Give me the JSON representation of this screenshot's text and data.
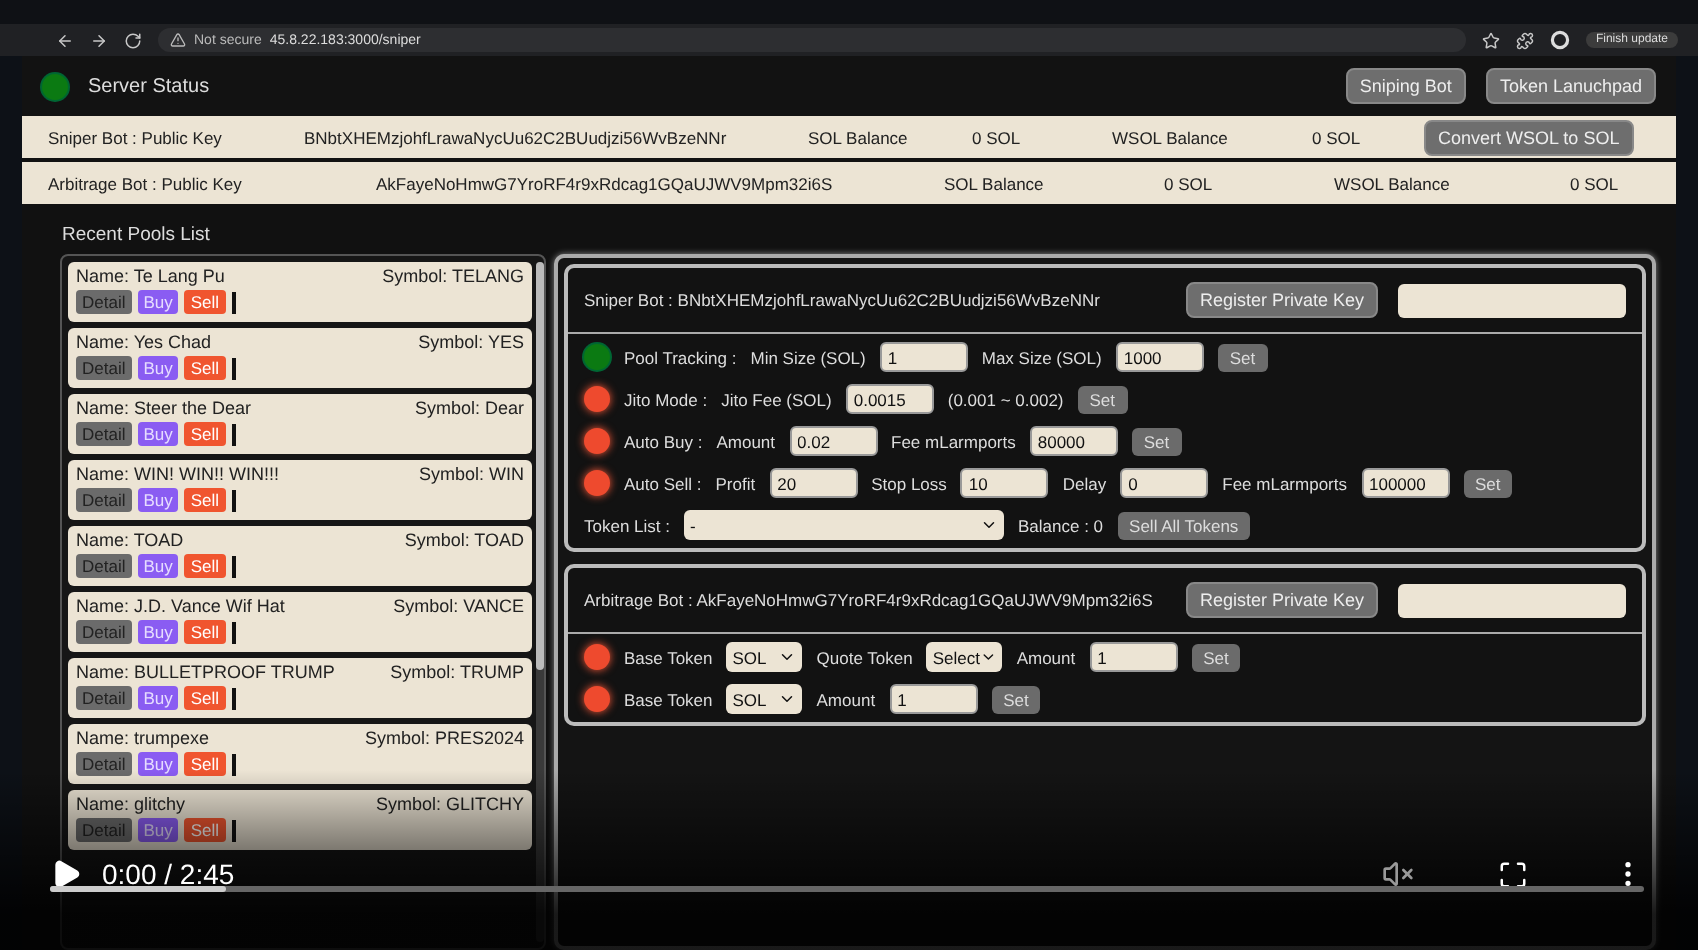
{
  "browser": {
    "security": "Not secure",
    "url": "45.8.22.183:3000/sniper",
    "update_button": "Finish update"
  },
  "header": {
    "server_status": {
      "label": "Server Status",
      "on": true
    },
    "buttons": [
      "Sniping Bot",
      "Token Lanuchpad"
    ]
  },
  "accounts": [
    {
      "label": "Sniper Bot : Public Key",
      "key": "BNbtXHEMzjohfLrawaNycUu62C2BUudjzi56WvBzeNNr",
      "balances": [
        {
          "label": "SOL Balance",
          "value": "0 SOL"
        },
        {
          "label": "WSOL Balance",
          "value": "0 SOL"
        }
      ],
      "button": "Convert WSOL to SOL"
    },
    {
      "label": "Arbitrage Bot : Public Key",
      "key": "AkFayeNoHmwG7YroRF4r9xRdcag1GQaUJWV9Mpm32i6S",
      "balances": [
        {
          "label": "SOL Balance",
          "value": "0 SOL"
        },
        {
          "label": "WSOL Balance",
          "value": "0 SOL"
        }
      ]
    }
  ],
  "pools": {
    "title": "Recent Pools List",
    "items": [
      {
        "name": "Name: Te Lang Pu",
        "symbol": "Symbol: TELANG",
        "actions": [
          {
            "label": "Detail",
            "kind": "detail"
          },
          {
            "label": "Buy",
            "kind": "buy"
          },
          {
            "label": "Sell",
            "kind": "sell"
          }
        ]
      },
      {
        "name": "Name: Yes Chad",
        "symbol": "Symbol: YES",
        "actions": [
          {
            "label": "Detail",
            "kind": "detail"
          },
          {
            "label": "Buy",
            "kind": "buy"
          },
          {
            "label": "Sell",
            "kind": "sell"
          }
        ]
      },
      {
        "name": "Name: Steer the Dear",
        "symbol": "Symbol: Dear",
        "actions": [
          {
            "label": "Detail",
            "kind": "detail"
          },
          {
            "label": "Buy",
            "kind": "buy"
          },
          {
            "label": "Sell",
            "kind": "sell"
          }
        ]
      },
      {
        "name": "Name: WIN! WIN!! WIN!!!",
        "symbol": "Symbol: WIN",
        "actions": [
          {
            "label": "Detail",
            "kind": "detail"
          },
          {
            "label": "Buy",
            "kind": "buy"
          },
          {
            "label": "Sell",
            "kind": "sell"
          }
        ]
      },
      {
        "name": "Name: TOAD",
        "symbol": "Symbol: TOAD",
        "actions": [
          {
            "label": "Detail",
            "kind": "detail"
          },
          {
            "label": "Buy",
            "kind": "buy"
          },
          {
            "label": "Sell",
            "kind": "sell"
          }
        ]
      },
      {
        "name": "Name: J.D. Vance Wif Hat",
        "symbol": "Symbol: VANCE",
        "actions": [
          {
            "label": "Detail",
            "kind": "detail"
          },
          {
            "label": "Buy",
            "kind": "buy"
          },
          {
            "label": "Sell",
            "kind": "sell"
          }
        ]
      },
      {
        "name": "Name: BULLETPROOF TRUMP",
        "symbol": "Symbol: TRUMP",
        "actions": [
          {
            "label": "Detail",
            "kind": "detail"
          },
          {
            "label": "Buy",
            "kind": "buy"
          },
          {
            "label": "Sell",
            "kind": "sell"
          }
        ]
      },
      {
        "name": "Name: trumpexe",
        "symbol": "Symbol: PRES2024",
        "actions": [
          {
            "label": "Detail",
            "kind": "detail"
          },
          {
            "label": "Buy",
            "kind": "buy"
          },
          {
            "label": "Sell",
            "kind": "sell"
          }
        ]
      },
      {
        "name": "Name: glitchy",
        "symbol": "Symbol: GLITCHY",
        "actions": [
          {
            "label": "Detail",
            "kind": "detail"
          },
          {
            "label": "Buy",
            "kind": "buy"
          },
          {
            "label": "Sell",
            "kind": "sell"
          }
        ]
      }
    ]
  },
  "bot_panels": [
    {
      "title": "Sniper Bot : BNbtXHEMzjohfLrawaNycUu62C2BUudjzi56WvBzeNNr",
      "register_button": "Register Private Key",
      "rows": [
        {
          "on": true,
          "items": [
            {
              "kind": "label",
              "text": "Pool Tracking :"
            },
            {
              "kind": "label",
              "text": "Min Size (SOL)"
            },
            {
              "kind": "input",
              "value": "1"
            },
            {
              "kind": "label",
              "text": "Max Size (SOL)"
            },
            {
              "kind": "input",
              "value": "1000"
            },
            {
              "kind": "button",
              "text": "Set"
            }
          ]
        },
        {
          "on": false,
          "items": [
            {
              "kind": "label",
              "text": "Jito Mode :"
            },
            {
              "kind": "label",
              "text": "Jito Fee (SOL)"
            },
            {
              "kind": "input",
              "value": "0.0015"
            },
            {
              "kind": "label",
              "text": "(0.001 ~ 0.002)"
            },
            {
              "kind": "button",
              "text": "Set"
            }
          ]
        },
        {
          "on": false,
          "items": [
            {
              "kind": "label",
              "text": "Auto Buy :"
            },
            {
              "kind": "label",
              "text": "Amount"
            },
            {
              "kind": "input",
              "value": "0.02"
            },
            {
              "kind": "label",
              "text": "Fee mLarmports"
            },
            {
              "kind": "input",
              "value": "80000"
            },
            {
              "kind": "button",
              "text": "Set"
            }
          ]
        },
        {
          "on": false,
          "items": [
            {
              "kind": "label",
              "text": "Auto Sell :"
            },
            {
              "kind": "label",
              "text": "Profit"
            },
            {
              "kind": "input",
              "value": "20"
            },
            {
              "kind": "label",
              "text": "Stop Loss"
            },
            {
              "kind": "input",
              "value": "10"
            },
            {
              "kind": "label",
              "text": "Delay"
            },
            {
              "kind": "input",
              "value": "0"
            },
            {
              "kind": "label",
              "text": "Fee mLarmports"
            },
            {
              "kind": "input",
              "value": "100000"
            },
            {
              "kind": "button",
              "text": "Set"
            }
          ]
        },
        {
          "items": [
            {
              "kind": "label",
              "text": "Token List :"
            },
            {
              "kind": "wideselect",
              "value": "-"
            },
            {
              "kind": "label",
              "text": "Balance : 0"
            },
            {
              "kind": "button",
              "text": "Sell All Tokens"
            }
          ]
        }
      ]
    },
    {
      "title": "Arbitrage Bot : AkFayeNoHmwG7YroRF4r9xRdcag1GQaUJWV9Mpm32i6S",
      "register_button": "Register Private Key",
      "rows": [
        {
          "on": false,
          "items": [
            {
              "kind": "label",
              "text": "Base Token"
            },
            {
              "kind": "select",
              "value": "SOL"
            },
            {
              "kind": "label",
              "text": "Quote Token"
            },
            {
              "kind": "select",
              "value": "Select"
            },
            {
              "kind": "label",
              "text": "Amount"
            },
            {
              "kind": "input",
              "value": "1"
            },
            {
              "kind": "button",
              "text": "Set"
            }
          ]
        },
        {
          "on": false,
          "items": [
            {
              "kind": "label",
              "text": "Base Token"
            },
            {
              "kind": "select",
              "value": "SOL"
            },
            {
              "kind": "label",
              "text": "Amount"
            },
            {
              "kind": "input",
              "value": "1"
            },
            {
              "kind": "button",
              "text": "Set"
            }
          ]
        }
      ]
    }
  ],
  "video": {
    "time": "0:00 / 2:45",
    "level": 0.11,
    "muted": true
  }
}
